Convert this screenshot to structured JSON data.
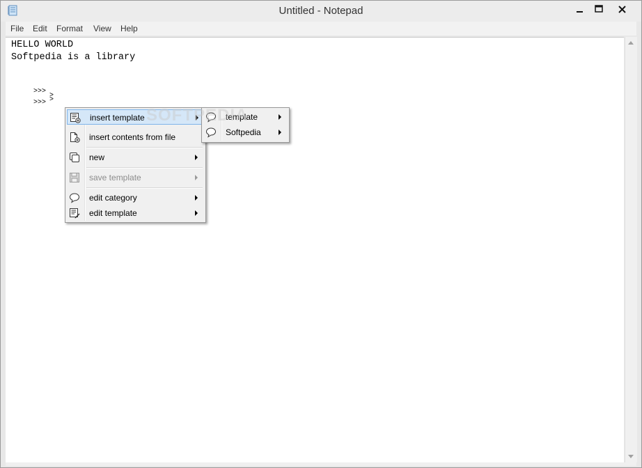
{
  "window": {
    "title": "Untitled - Notepad",
    "controls": {
      "minimize": "—",
      "maximize": "☐",
      "close": "✕"
    }
  },
  "menubar": {
    "items": [
      {
        "label": "File"
      },
      {
        "label": "Edit"
      },
      {
        "label": "Format"
      },
      {
        "label": "View"
      },
      {
        "label": "Help"
      }
    ]
  },
  "editor": {
    "lines": [
      "HELLO WORLD",
      "Softpedia is a library"
    ],
    "prompts": [
      ">>>",
      ">",
      ">>>",
      ">"
    ]
  },
  "context_menu": {
    "items": [
      {
        "label": "insert template",
        "icon": "template-insert-icon",
        "submenu": true,
        "highlighted": true,
        "disabled": false
      },
      {
        "label": "insert contents from file",
        "icon": "file-insert-icon",
        "submenu": false,
        "highlighted": false,
        "disabled": false
      },
      {
        "label": "new",
        "icon": "new-window-icon",
        "submenu": true,
        "highlighted": false,
        "disabled": false
      },
      {
        "label": "save template",
        "icon": "floppy-disk-icon",
        "submenu": true,
        "highlighted": false,
        "disabled": true
      },
      {
        "label": "edit category",
        "icon": "speech-bubble-icon",
        "submenu": true,
        "highlighted": false,
        "disabled": false
      },
      {
        "label": "edit template",
        "icon": "template-edit-icon",
        "submenu": true,
        "highlighted": false,
        "disabled": false
      }
    ]
  },
  "submenu": {
    "items": [
      {
        "label": "template",
        "icon": "speech-bubble-icon",
        "submenu": true
      },
      {
        "label": "Softpedia",
        "icon": "speech-bubble-icon",
        "submenu": true
      }
    ]
  },
  "watermark": "SOFTPEDIA",
  "colors": {
    "highlight_bg": "#d5e7f8",
    "highlight_border": "#7eb4ea",
    "menu_bg": "#f0f0f0",
    "disabled_text": "#8c8c8c"
  }
}
